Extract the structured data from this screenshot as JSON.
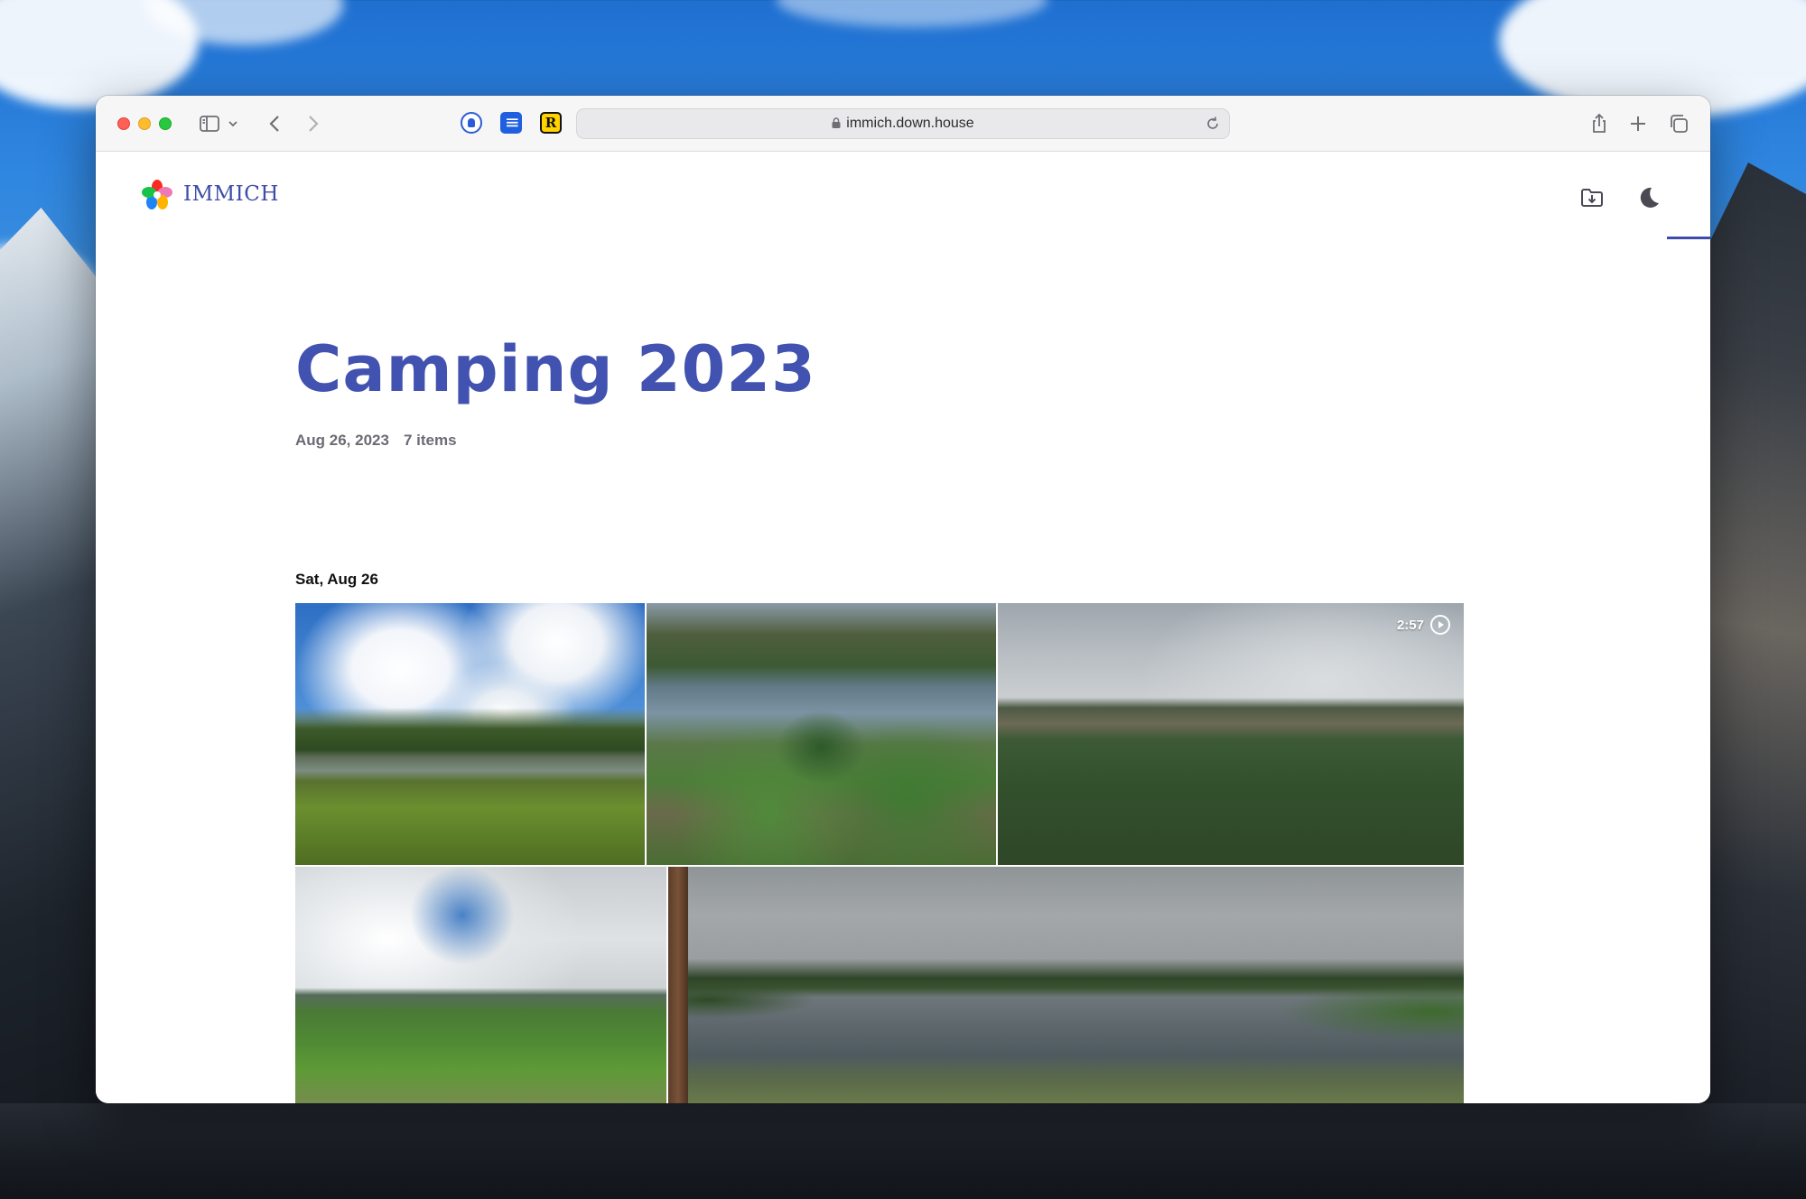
{
  "browser": {
    "url": "immich.down.house"
  },
  "app": {
    "brand": "IMMICH"
  },
  "album": {
    "title": "Camping 2023",
    "date": "Aug 26, 2023",
    "item_count": "7 items",
    "groups": [
      {
        "date_heading": "Sat, Aug 26",
        "photos": [
          {
            "kind": "photo",
            "subject": "lake-meadow-blue-sky"
          },
          {
            "kind": "photo",
            "subject": "campsite-tents-by-lake"
          },
          {
            "kind": "video",
            "subject": "forest-hillside-cloudy",
            "duration": "2:57"
          },
          {
            "kind": "photo",
            "subject": "valley-green-hills"
          },
          {
            "kind": "photo",
            "subject": "lake-panorama-overcast"
          }
        ]
      }
    ]
  },
  "icons": {
    "toolbar": [
      "sidebar-icon",
      "chevron-down-icon",
      "back-icon",
      "forward-icon",
      "share-icon",
      "new-tab-icon",
      "tabs-overview-icon",
      "reload-icon",
      "lock-icon"
    ],
    "header": [
      "download-folder-icon",
      "moon-icon"
    ],
    "video": "play-circle-icon"
  },
  "colors": {
    "brand": "#3d4ca8",
    "title": "#4252b0"
  }
}
